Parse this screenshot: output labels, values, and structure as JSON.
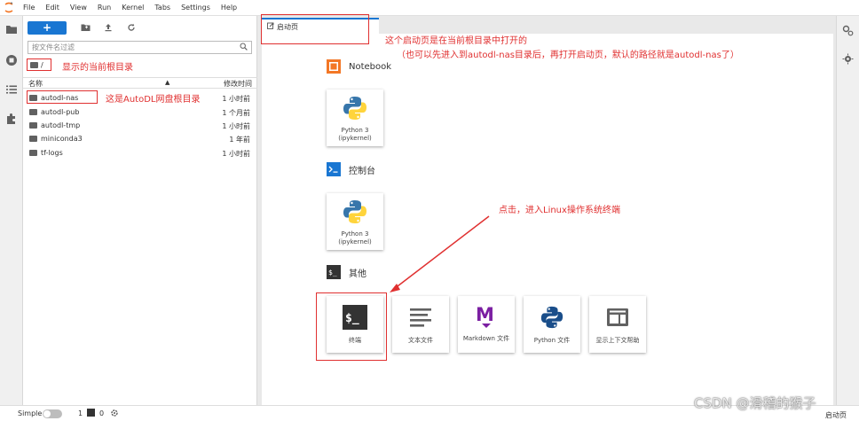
{
  "menu": [
    "File",
    "Edit",
    "View",
    "Run",
    "Kernel",
    "Tabs",
    "Settings",
    "Help"
  ],
  "filebrowser": {
    "new_label": "+",
    "filter_placeholder": "按文件名过滤",
    "breadcrumb": "/",
    "col_name": "名称",
    "col_modified": "修改时间",
    "files": [
      {
        "name": "autodl-nas",
        "modified": "1 小时前"
      },
      {
        "name": "autodl-pub",
        "modified": "1 个月前"
      },
      {
        "name": "autodl-tmp",
        "modified": "1 小时前"
      },
      {
        "name": "miniconda3",
        "modified": "1 年前"
      },
      {
        "name": "tf-logs",
        "modified": "1 小时前"
      }
    ]
  },
  "tab": {
    "label": "启动页"
  },
  "launcher": {
    "notebook_title": "Notebook",
    "console_title": "控制台",
    "other_title": "其他",
    "notebook_card": {
      "line1": "Python 3",
      "line2": "(ipykernel)"
    },
    "console_card": {
      "line1": "Python 3",
      "line2": "(ipykernel)"
    },
    "other_cards": [
      "终端",
      "文本文件",
      "Markdown 文件",
      "Python 文件",
      "显示上下文帮助"
    ]
  },
  "annotations": {
    "root_dir": "显示的当前根目录",
    "autodl_disk": "这是AutoDL网盘根目录",
    "launcher_line1": "这个启动页是在当前根目录中打开的",
    "launcher_line2": "（也可以先进入到autodl-nas目录后，再打开启动页，默认的路径就是autodl-nas了）",
    "terminal_hint": "点击，进入Linux操作系统终端"
  },
  "status": {
    "mode": "Simple",
    "kernels": "1",
    "terminals": "0",
    "right": "启动页"
  },
  "watermark": "CSDN @滑稽的猴子",
  "colors": {
    "accent": "#1976d2",
    "annotation": "#e03030",
    "orange": "#f37726"
  }
}
